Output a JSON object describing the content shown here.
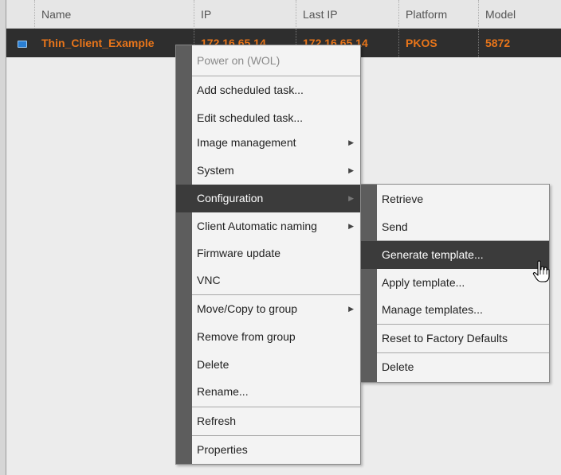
{
  "columns": [
    "Name",
    "IP",
    "Last IP",
    "Platform",
    "Model"
  ],
  "selected_row": {
    "name": "Thin_Client_Example",
    "ip": "172.16.65.14",
    "last_ip": "172.16.65.14",
    "platform": "PKOS",
    "model": "5872"
  },
  "context_menu": {
    "items": [
      {
        "label": "Power on (WOL)"
      },
      {
        "label": "Add scheduled task..."
      },
      {
        "label": "Edit scheduled task..."
      },
      {
        "label": "Image management"
      },
      {
        "label": "System"
      },
      {
        "label": "Configuration"
      },
      {
        "label": "Client Automatic naming"
      },
      {
        "label": "Firmware update"
      },
      {
        "label": "VNC"
      },
      {
        "label": "Move/Copy to group"
      },
      {
        "label": "Remove from group"
      },
      {
        "label": "Delete"
      },
      {
        "label": "Rename..."
      },
      {
        "label": "Refresh"
      },
      {
        "label": "Properties"
      }
    ]
  },
  "submenu": {
    "items": [
      {
        "label": "Retrieve"
      },
      {
        "label": "Send"
      },
      {
        "label": "Generate template..."
      },
      {
        "label": "Apply template..."
      },
      {
        "label": "Manage templates..."
      },
      {
        "label": "Reset to Factory Defaults"
      },
      {
        "label": "Delete"
      }
    ]
  },
  "colors": {
    "accent_text": "#e8751a",
    "highlight": "#3b3b3b",
    "gutter": "#5d5d5d"
  },
  "icons": {
    "row_icon": "device-icon",
    "submenu_arrow": "chevron-right-icon",
    "cursor": "hand-pointer-icon"
  }
}
